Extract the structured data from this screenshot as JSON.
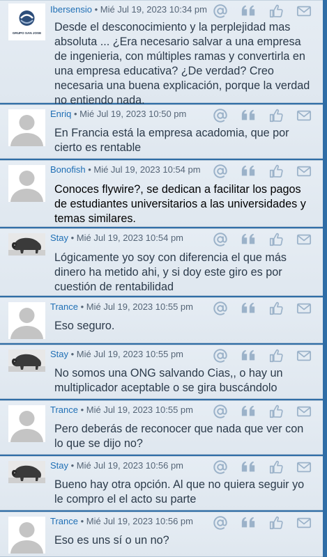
{
  "posts": [
    {
      "author": "Ibersensio",
      "date": "Mié Jul 19, 2023 10:34 pm",
      "avatar": "logo",
      "avatar_text": "GRUPO SAN JOSE",
      "text": "Desde el desconocimiento y la perplejidad mas absoluta ... ¿Era necesario salvar a una empresa de ingenieria, con múltiples ramas y convertirla en una empresa educativa? ¿De verdad? Creo necesaria una buena explicación, porque la verdad no entiendo nada."
    },
    {
      "author": "Enriq",
      "date": "Mié Jul 19, 2023 10:50 pm",
      "avatar": "default",
      "text": "En Francia está la empresa acadomia, que por cierto es rentable"
    },
    {
      "author": "Bonofish",
      "date": "Mié Jul 19, 2023 10:54 pm",
      "avatar": "default",
      "text": "Conoces flywire?, se dedican a facilitar los pagos de estudiantes universitarios a las universidades y temas similares."
    },
    {
      "author": "Stay",
      "date": "Mié Jul 19, 2023 10:54 pm",
      "avatar": "bison",
      "text": "Lógicamente yo soy con diferencia el que más dinero ha metido ahi, y si doy este giro es por cuestión de rentabilidad"
    },
    {
      "author": "Trance",
      "date": "Mié Jul 19, 2023 10:55 pm",
      "avatar": "default",
      "text": "Eso seguro."
    },
    {
      "author": "Stay",
      "date": "Mié Jul 19, 2023 10:55 pm",
      "avatar": "bison",
      "text": "No somos una ONG salvando Cias,, o hay un multiplicador aceptable o se gira buscándolo"
    },
    {
      "author": "Trance",
      "date": "Mié Jul 19, 2023 10:55 pm",
      "avatar": "default",
      "text": "Pero deberás de reconocer que nada que ver con lo que se dijo no?"
    },
    {
      "author": "Stay",
      "date": "Mié Jul 19, 2023 10:56 pm",
      "avatar": "bison",
      "text": "Bueno hay otra opción. Al que no quiera seguir yo le compro el el acto su parte"
    },
    {
      "author": "Trance",
      "date": "Mié Jul 19, 2023 10:56 pm",
      "avatar": "default",
      "text": "Eso es uns sí o un no?"
    }
  ],
  "icons": [
    "mention-icon",
    "quote-icon",
    "like-icon",
    "message-icon"
  ],
  "colors": {
    "author": "#1f6fb5",
    "icon": "#9bb2c9",
    "background": "#2f6da6"
  }
}
